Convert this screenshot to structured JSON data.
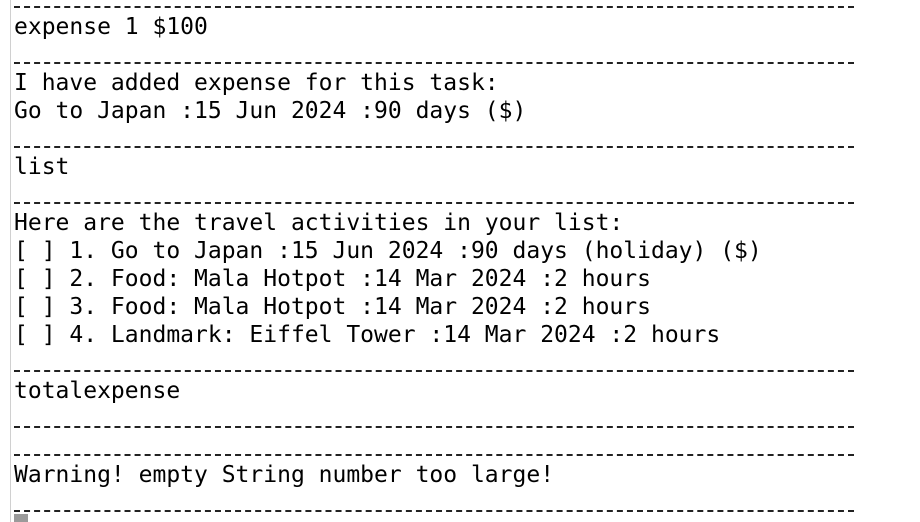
{
  "terminal": {
    "lines": {
      "cmd_expense": "expense 1 $100",
      "added_msg": "I have added expense for this task:",
      "added_task": "Go to Japan :15 Jun 2024 :90 days ($)",
      "cmd_list": "list",
      "list_header": "Here are the travel activities in your list:",
      "item_1": "[ ] 1. Go to Japan :15 Jun 2024 :90 days (holiday) ($)",
      "item_2": "[ ] 2. Food: Mala Hotpot :14 Mar 2024 :2 hours",
      "item_3": "[ ] 3. Food: Mala Hotpot :14 Mar 2024 :2 hours",
      "item_4": "[ ] 4. Landmark: Eiffel Tower :14 Mar 2024 :2 hours",
      "cmd_total": "totalexpense",
      "warning": "Warning! empty String number too large!"
    }
  }
}
